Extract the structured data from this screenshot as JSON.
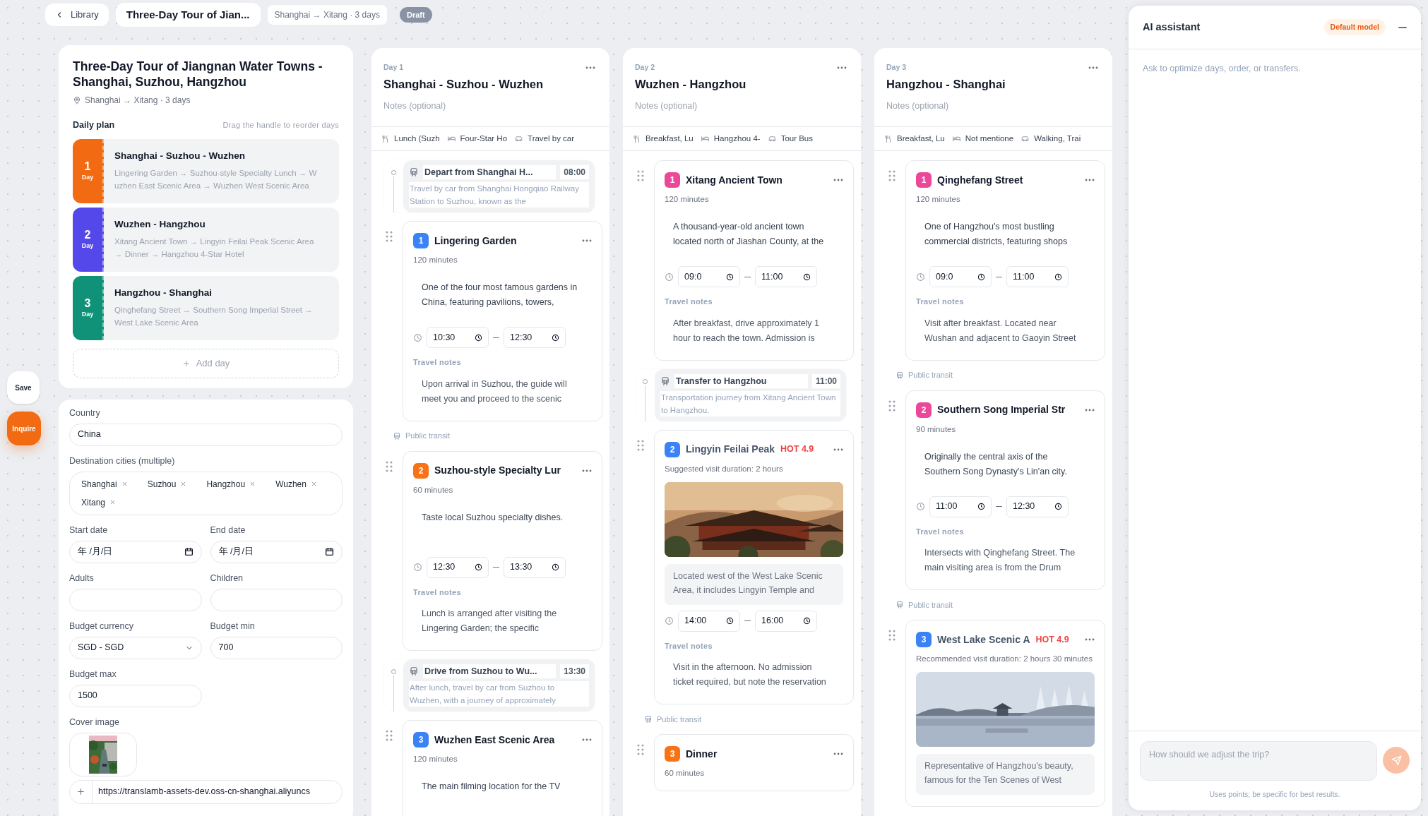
{
  "topbar": {
    "back": "Library",
    "title": "Three-Day Tour of Jian...",
    "route": "Shanghai → Xitang · 3 days",
    "status": "Draft"
  },
  "side_actions": [
    {
      "label": "Save",
      "kind": "secondary"
    },
    {
      "label": "Inquire",
      "kind": "primary"
    }
  ],
  "overview": {
    "title": "Three-Day Tour of Jiangnan Water Towns - Shanghai, Suzhou, Hangzhou",
    "location": "Shanghai → Xitang · 3 days",
    "plan_heading": "Daily plan",
    "plan_hint": "Drag the handle to reorder days",
    "add_day": "Add day",
    "days": [
      {
        "number": "1",
        "unit": "Day",
        "title": "Shanghai - Suzhou - Wuzhen",
        "route": "Lingering Garden → Suzhou-style Specialty Lunch → Wuzhen East Scenic Area → Wuzhen West Scenic Area",
        "color": "#f26a12"
      },
      {
        "number": "2",
        "unit": "Day",
        "title": "Wuzhen - Hangzhou",
        "route": "Xitang Ancient Town → Lingyin Feilai Peak Scenic Area → Dinner → Hangzhou 4-Star Hotel",
        "color": "#5548ea"
      },
      {
        "number": "3",
        "unit": "Day",
        "title": "Hangzhou - Shanghai",
        "route": "Qinghefang Street → Southern Song Imperial Street → West Lake Scenic Area",
        "color": "#0f9277"
      }
    ]
  },
  "trip_form": {
    "country": {
      "label": "Country",
      "value": "China"
    },
    "cities": {
      "label": "Destination cities (multiple)",
      "tags": [
        "Shanghai",
        "Suzhou",
        "Hangzhou",
        "Wuzhen",
        "Xitang"
      ]
    },
    "start_date": {
      "label": "Start date",
      "value": "年 /月/日"
    },
    "end_date": {
      "label": "End date",
      "value": "年 /月/日"
    },
    "adults": {
      "label": "Adults"
    },
    "children": {
      "label": "Children"
    },
    "budget_currency": {
      "label": "Budget currency",
      "value": "SGD - SGD"
    },
    "budget_min": {
      "label": "Budget min",
      "value": "700"
    },
    "budget_max": {
      "label": "Budget max",
      "value": "1500"
    },
    "cover_image": {
      "label": "Cover image",
      "url": "https://translamb-assets-dev.oss-cn-shanghai.aliyuncs"
    }
  },
  "days": [
    {
      "label": "Day 1",
      "title": "Shanghai - Suzhou - Wuzhen",
      "notes_placeholder": "Notes (optional)",
      "summary": {
        "meals": "Lunch (Suzh",
        "hotel": "Four-Star Ho",
        "transport": "Travel by car"
      },
      "items": [
        {
          "kind": "transfer",
          "title": "Depart from Shanghai H...",
          "time": "08:00",
          "description": "Travel by car from Shanghai Hongqiao Railway Station to Suzhou, known as the"
        },
        {
          "kind": "activity",
          "number": "1",
          "color": "#3b82f6",
          "title": "Lingering Garden",
          "duration": "120 minutes",
          "description": "One of the four most famous gardens in China, featuring pavilions, towers,",
          "start": "10:30",
          "end": "12:30",
          "notes_label": "Travel notes",
          "notes": "Upon arrival in Suzhou, the guide will meet you and proceed to the scenic"
        },
        {
          "kind": "transit",
          "label": "Public transit"
        },
        {
          "kind": "activity",
          "number": "2",
          "color": "#f97316",
          "title": "Suzhou-style Specialty Lur",
          "duration": "60 minutes",
          "description": "Taste local Suzhou specialty dishes.",
          "start": "12:30",
          "end": "13:30",
          "notes_label": "Travel notes",
          "notes": "Lunch is arranged after visiting the Lingering Garden; the specific"
        },
        {
          "kind": "transfer",
          "title": "Drive from Suzhou to Wu...",
          "time": "13:30",
          "description": "After lunch, travel by car from Suzhou to Wuzhen, with a journey of approximately"
        },
        {
          "kind": "activity",
          "number": "3",
          "color": "#3b82f6",
          "title": "Wuzhen East Scenic Area",
          "duration": "120 minutes",
          "description": "The main filming location for the TV"
        }
      ]
    },
    {
      "label": "Day 2",
      "title": "Wuzhen - Hangzhou",
      "notes_placeholder": "Notes (optional)",
      "summary": {
        "meals": "Breakfast, Lu",
        "hotel": "Hangzhou 4-",
        "transport": "Tour Bus"
      },
      "items": [
        {
          "kind": "activity",
          "number": "1",
          "color": "#ec4899",
          "title": "Xitang Ancient Town",
          "duration": "120 minutes",
          "description": "A thousand-year-old ancient town located north of Jiashan County, at the",
          "start": "09:0",
          "end": "11:00",
          "notes_label": "Travel notes",
          "notes": "After breakfast, drive approximately 1 hour to reach the town. Admission is"
        },
        {
          "kind": "transfer",
          "title": "Transfer to Hangzhou",
          "time": "11:00",
          "description": "Transportation journey from Xitang Ancient Town to Hangzhou."
        },
        {
          "kind": "activity",
          "number": "2",
          "color": "#3b82f6",
          "title": "Lingyin Feilai Peak",
          "hot": "HOT 4.9",
          "duration": "Suggested visit duration: 2 hours",
          "description": "Located west of the West Lake Scenic Area, it includes Lingyin Temple and",
          "start": "14:00",
          "end": "16:00",
          "notes_label": "Travel notes",
          "notes": "Visit in the afternoon. No admission ticket required, but note the reservation"
        },
        {
          "kind": "transit",
          "label": "Public transit"
        },
        {
          "kind": "activity",
          "number": "3",
          "color": "#f97316",
          "title": "Dinner",
          "duration": "60 minutes"
        }
      ]
    },
    {
      "label": "Day 3",
      "title": "Hangzhou - Shanghai",
      "notes_placeholder": "Notes (optional)",
      "summary": {
        "meals": "Breakfast, Lu",
        "hotel": "Not mentione",
        "transport": "Walking, Trai"
      },
      "items": [
        {
          "kind": "activity",
          "number": "1",
          "color": "#ec4899",
          "title": "Qinghefang Street",
          "duration": "120 minutes",
          "description": "One of Hangzhou's most bustling commercial districts, featuring shops",
          "start": "09:0",
          "end": "11:00",
          "notes_label": "Travel notes",
          "notes": "Visit after breakfast. Located near Wushan and adjacent to Gaoyin Street"
        },
        {
          "kind": "transit",
          "label": "Public transit"
        },
        {
          "kind": "activity",
          "number": "2",
          "color": "#ec4899",
          "title": "Southern Song Imperial Str",
          "duration": "90 minutes",
          "description": "Originally the central axis of the Southern Song Dynasty's Lin'an city.",
          "start": "11:00",
          "end": "12:30",
          "notes_label": "Travel notes",
          "notes": "Intersects with Qinghefang Street. The main visiting area is from the Drum"
        },
        {
          "kind": "transit",
          "label": "Public transit"
        },
        {
          "kind": "activity",
          "number": "3",
          "color": "#3b82f6",
          "title": "West Lake Scenic A",
          "hot": "HOT 4.9",
          "duration": "Recommended visit duration: 2 hours 30 minutes",
          "description": "Representative of Hangzhou's beauty, famous for the Ten Scenes of West"
        }
      ]
    }
  ],
  "assistant": {
    "title": "AI assistant",
    "model": "Default model",
    "hint": "Ask to optimize days, order, or transfers.",
    "input_placeholder": "How should we adjust the trip?",
    "footer": "Uses points; be specific for best results."
  }
}
